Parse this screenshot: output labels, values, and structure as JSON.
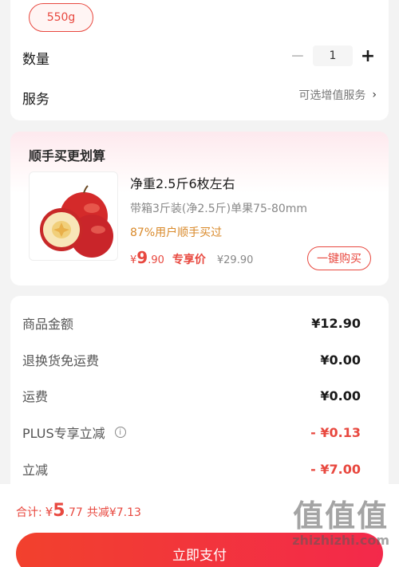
{
  "spec": {
    "selected_option": "550g"
  },
  "quantity": {
    "label": "数量",
    "minus_icon": "−",
    "value": "1",
    "plus_icon": "+"
  },
  "service": {
    "label": "服务",
    "link_text": "可选增值服务",
    "chevron": "›"
  },
  "bundle": {
    "title": "顺手买更划算",
    "product": {
      "name": "净重2.5斤6枚左右",
      "spec": "带箱3斤装(净2.5斤)单果75-80mm",
      "hint": "87%用户顺手买过",
      "price_yen": "¥",
      "price_int": "9",
      "price_dec": ".90",
      "price_tag": "专享价",
      "original_price": "¥29.90",
      "buy_button": "一键购买"
    }
  },
  "summary": {
    "rows": [
      {
        "label": "商品金额",
        "value": "¥12.90",
        "color": "#1a1a1a"
      },
      {
        "label": "退换货免运费",
        "value": "¥0.00",
        "color": "#1a1a1a"
      },
      {
        "label": "运费",
        "value": "¥0.00",
        "color": "#1a1a1a"
      },
      {
        "label": "PLUS专享立减",
        "value": "- ¥0.13",
        "color": "#e8483f",
        "info_icon": "i"
      },
      {
        "label": "立减",
        "value": "- ¥7.00",
        "color": "#e8483f"
      }
    ]
  },
  "checkout": {
    "total_label": "合计:",
    "total_yen": "¥",
    "total_int": "5",
    "total_dec": ".77",
    "saved_text": "共减¥7.13",
    "pay_button": "立即支付"
  },
  "watermark": {
    "logo": "值值值",
    "url": "zhizhizhi.com"
  },
  "colors": {
    "accent": "#e8483f",
    "hint": "#d9892a",
    "page_bg": "#f3f3f3"
  }
}
